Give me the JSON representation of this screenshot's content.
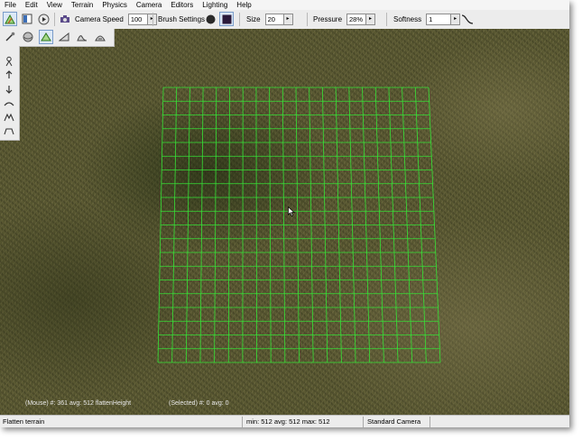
{
  "menu": [
    "File",
    "Edit",
    "View",
    "Terrain",
    "Physics",
    "Camera",
    "Editors",
    "Lighting",
    "Help"
  ],
  "toolbar": {
    "camera_speed_label": "Camera Speed",
    "camera_speed_value": "100",
    "brush_settings_label": "Brush Settings",
    "size_label": "Size",
    "size_value": "20",
    "pressure_label": "Pressure",
    "pressure_value": "28%",
    "softness_label": "Softness",
    "softness_value": "1",
    "arrow": "▸"
  },
  "viewport": {
    "mouse_readout": "(Mouse) #: 361  avg: 512 flattenHeight",
    "selected_readout": "(Selected) #: 0  avg: 0"
  },
  "status": {
    "mode": "Flatten terrain",
    "stats": "min: 512  avg: 512  max: 512",
    "camera": "Standard Camera"
  },
  "colors": {
    "grid": "#36e236",
    "terrain_base": "#5c5a33"
  }
}
